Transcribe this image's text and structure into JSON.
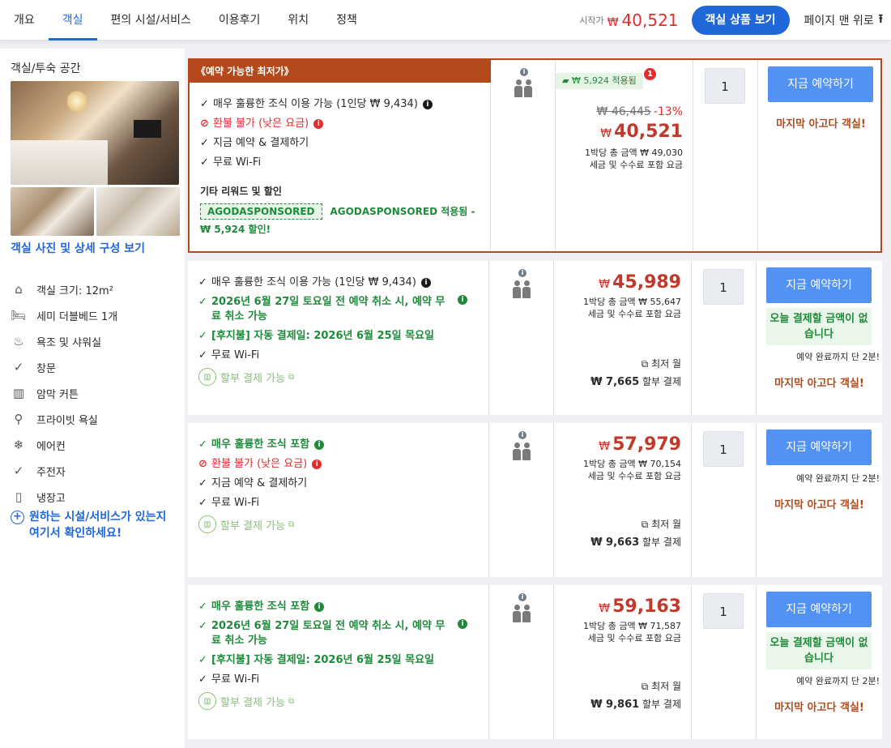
{
  "nav": {
    "tabs": [
      "개요",
      "객실",
      "편의 시설/서비스",
      "이용후기",
      "위치",
      "정책"
    ],
    "active_tab": 1,
    "start_price_label": "시작가",
    "start_price_currency": "₩",
    "start_price": "40,521",
    "view_rooms_label": "객실 상품 보기",
    "to_top_label": "페이지 맨 위로"
  },
  "left": {
    "title": "객실/투숙 공간",
    "photo_link": "객실 사진 및 상세 구성 보기",
    "amenities": [
      {
        "icon": "house-icon",
        "label": "객실 크기: 12m²"
      },
      {
        "icon": "bed-icon",
        "label": "세미 더블베드 1개"
      },
      {
        "icon": "shower-icon",
        "label": "욕조 및 샤워실"
      },
      {
        "icon": "check-circle-icon",
        "label": "창문"
      },
      {
        "icon": "curtain-icon",
        "label": "암막 커튼"
      },
      {
        "icon": "toilet-icon",
        "label": "프라이빗 욕실"
      },
      {
        "icon": "snowflake-icon",
        "label": "에어컨"
      },
      {
        "icon": "check-circle-icon",
        "label": "주전자"
      },
      {
        "icon": "fridge-icon",
        "label": "냉장고"
      }
    ],
    "more_link": "원하는 시설/서비스가 있는지 여기서 확인하세요!"
  },
  "rows": [
    {
      "banner": "《예약 가능한 최저가》",
      "features": [
        {
          "type": "check",
          "text": "매우 훌륭한 조식 이용 가능 (1인당 ₩ 9,434)",
          "info": true
        },
        {
          "type": "refund",
          "text": "환불 불가 (낮은 요금)",
          "info": true
        },
        {
          "type": "check",
          "text": "지금 예약 & 결제하기"
        },
        {
          "type": "check",
          "text": "무료 Wi-Fi"
        }
      ],
      "other_title": "기타 리워드 및 할인",
      "coupon_code": "AGODASPONSORED",
      "coupon_text": "AGODASPONSORED 적용됨 - ₩ 5,924 할인!",
      "applied_badge": "₩ 5,924 적용됨",
      "applied_count": "1",
      "original_price": "₩ 46,445",
      "discount": "-13%",
      "currency": "₩",
      "price": "40,521",
      "total_line": "1박당 총 금액 ₩ 49,030",
      "tax_line": "세금 및 수수료 포함 요금",
      "qty": "1",
      "book_label": "지금 예약하기",
      "last_room": "마지막 아고다 객실!"
    },
    {
      "features": [
        {
          "type": "check",
          "text": "매우 훌륭한 조식 이용 가능 (1인당 ₩ 9,434)",
          "info": true
        },
        {
          "type": "green",
          "text": "2026년 6월 27일 토요일 전 예약 취소 시, 예약 무료 취소 가능",
          "info": true
        },
        {
          "type": "green",
          "text": "[후지불] 자동 결제일: 2026년 6월 25일 목요일"
        },
        {
          "type": "check",
          "text": "무료 Wi-Fi"
        }
      ],
      "installment": "할부 결제 가능",
      "currency": "₩",
      "price": "45,989",
      "total_line": "1박당 총 금액 ₩ 55,647",
      "tax_line": "세금 및 수수료 포함 요금",
      "monthly_label": "최저 월",
      "monthly_amount": "₩ 7,665",
      "monthly_suffix": "할부 결제",
      "qty": "1",
      "book_label": "지금 예약하기",
      "pay_now": "오늘 결제할 금액이 없습니다",
      "two_min": "예약 완료까지 단 2분!",
      "last_room": "마지막 아고다 객실!"
    },
    {
      "features": [
        {
          "type": "green",
          "text": "매우 훌륭한 조식 포함",
          "info": true
        },
        {
          "type": "refund",
          "text": "환불 불가 (낮은 요금)",
          "info": true
        },
        {
          "type": "check",
          "text": "지금 예약 & 결제하기"
        },
        {
          "type": "check",
          "text": "무료 Wi-Fi"
        }
      ],
      "installment": "할부 결제 가능",
      "currency": "₩",
      "price": "57,979",
      "total_line": "1박당 총 금액 ₩ 70,154",
      "tax_line": "세금 및 수수료 포함 요금",
      "monthly_label": "최저 월",
      "monthly_amount": "₩ 9,663",
      "monthly_suffix": "할부 결제",
      "qty": "1",
      "book_label": "지금 예약하기",
      "two_min": "예약 완료까지 단 2분!",
      "last_room": "마지막 아고다 객실!"
    },
    {
      "features": [
        {
          "type": "green",
          "text": "매우 훌륭한 조식 포함",
          "info": true
        },
        {
          "type": "green",
          "text": "2026년 6월 27일 토요일 전 예약 취소 시, 예약 무료 취소 가능",
          "info": true
        },
        {
          "type": "green",
          "text": "[후지불] 자동 결제일: 2026년 6월 25일 목요일"
        },
        {
          "type": "check",
          "text": "무료 Wi-Fi"
        }
      ],
      "installment": "할부 결제 가능",
      "currency": "₩",
      "price": "59,163",
      "total_line": "1박당 총 금액 ₩ 71,587",
      "tax_line": "세금 및 수수료 포함 요금",
      "monthly_label": "최저 월",
      "monthly_amount": "₩ 9,861",
      "monthly_suffix": "할부 결제",
      "qty": "1",
      "book_label": "지금 예약하기",
      "pay_now": "오늘 결제할 금액이 없습니다",
      "two_min": "예약 완료까지 단 2분!",
      "last_room": "마지막 아고다 객실!"
    }
  ],
  "colors": {
    "accent_blue": "#2067da",
    "price_red": "#c0392b",
    "best_border": "#b44a1b",
    "green": "#1f8a3b"
  }
}
